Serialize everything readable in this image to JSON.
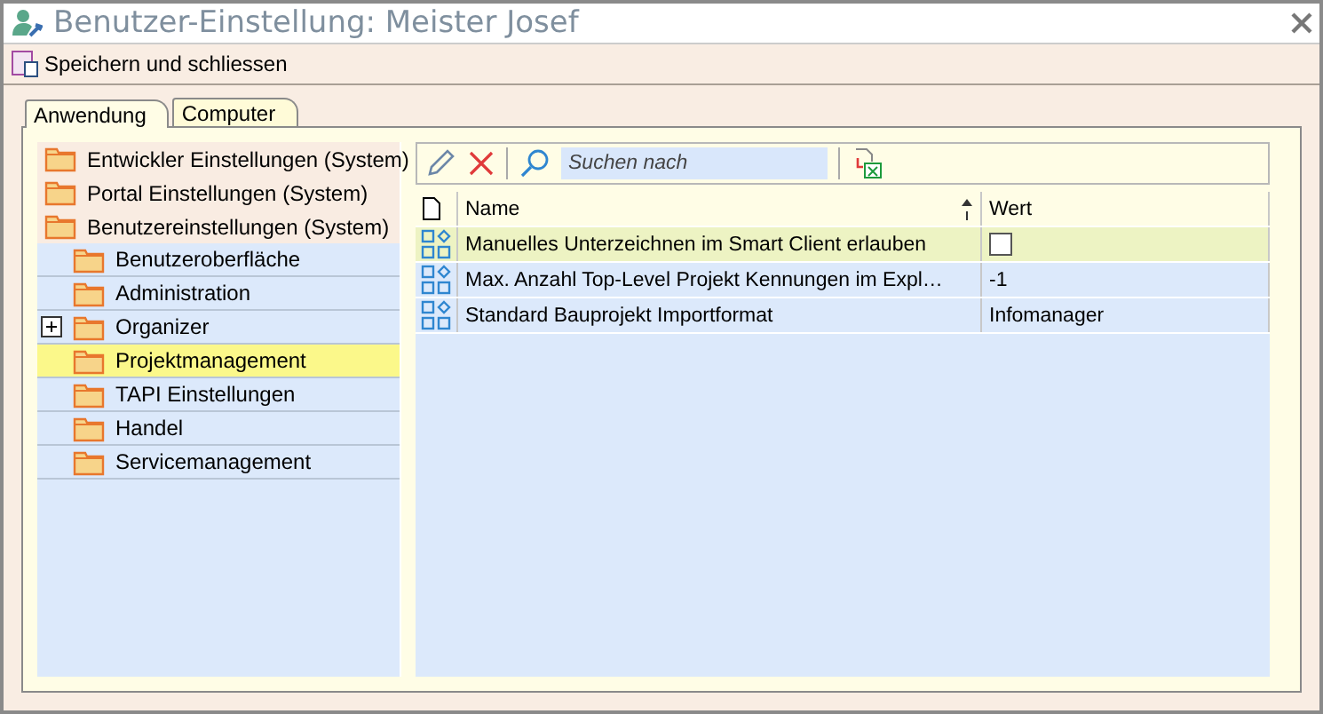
{
  "window": {
    "title": "Benutzer-Einstellung: Meister Josef"
  },
  "toolbar": {
    "save_label": "Speichern und schliessen"
  },
  "tabs": [
    {
      "label": "Anwendung",
      "selected": true
    },
    {
      "label": "Computer",
      "selected": false
    }
  ],
  "tree": {
    "items": [
      {
        "label": "Entwickler Einstellungen (System)",
        "selected": false
      },
      {
        "label": "Portal Einstellungen (System)",
        "selected": false
      },
      {
        "label": "Benutzereinstellungen (System)",
        "selected": false,
        "children": [
          {
            "label": "Benutzeroberfläche",
            "selected": false
          },
          {
            "label": "Administration",
            "selected": false
          },
          {
            "label": "Organizer",
            "selected": false,
            "expanded": false
          },
          {
            "label": "Projektmanagement",
            "selected": true
          },
          {
            "label": "TAPI Einstellungen",
            "selected": false
          },
          {
            "label": "Handel",
            "selected": false
          },
          {
            "label": "Servicemanagement",
            "selected": false
          }
        ]
      }
    ]
  },
  "search": {
    "placeholder": "Suchen nach"
  },
  "table": {
    "columns": [
      "Name",
      "Wert"
    ],
    "rows": [
      {
        "name": "Manuelles Unterzeichnen im Smart Client erlauben",
        "kind": "checkbox",
        "checked": false,
        "selected": true
      },
      {
        "name": "Max. Anzahl Top-Level Projekt Kennungen im Expl…",
        "kind": "text",
        "value": "-1",
        "selected": false
      },
      {
        "name": "Standard Bauprojekt Importformat",
        "kind": "text",
        "value": "Infomanager",
        "selected": false
      }
    ]
  }
}
